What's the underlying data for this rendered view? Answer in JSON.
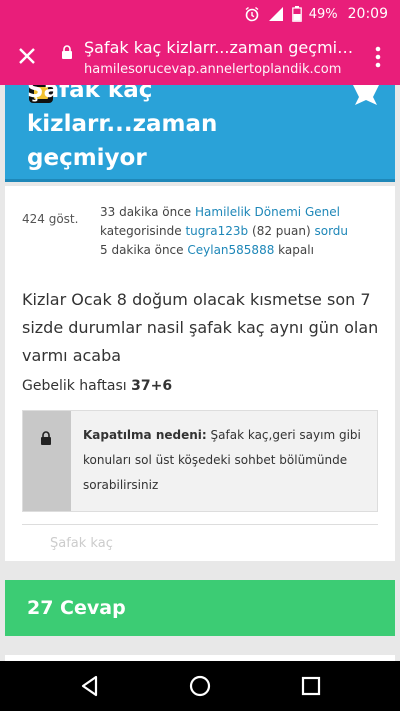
{
  "status_bar": {
    "battery": "49%",
    "time": "20:09",
    "icons": [
      "alarm-icon",
      "signal-icon",
      "battery-icon"
    ]
  },
  "browser": {
    "page_title": "Şafak kaç kizlarr...zaman geçmiyor",
    "url": "hamilesorucevap.annelertoplandik.com"
  },
  "question_header": {
    "title": "Şafak kaç kizlarr...zaman geçmiyor"
  },
  "meta": {
    "views": "424 göst.",
    "asked_time": "33 dakika önce",
    "category": "Hamilelik Dönemi Genel",
    "category_suffix": "kategorisinde",
    "asker": "tugra123b",
    "asker_points": "(82 puan)",
    "asked_label": "sordu",
    "closed_time": "5 dakika önce",
    "closer": "Ceylan585888",
    "closed_label": "kapalı"
  },
  "question_body": "Kizlar Ocak 8 doğum olacak kısmetse son 7 sizde durumlar nasil şafak kaç aynı gün olan varmı acaba",
  "pregnancy": {
    "label": "Gebelik haftası",
    "value": "37+6"
  },
  "closed_notice": {
    "label": "Kapatılma nedeni:",
    "text": "Şafak kaç,geri sayım gibi konuları sol üst köşedeki sohbet bölümünde sorabilirsiniz"
  },
  "ghost_text": "Şafak kaç",
  "answers": {
    "label": "27 Cevap"
  },
  "colors": {
    "browser_bar": "#e91e7a",
    "header_blue": "#2aa2d8",
    "answers_green": "#3ccc74",
    "link_blue": "#1e87b8"
  }
}
